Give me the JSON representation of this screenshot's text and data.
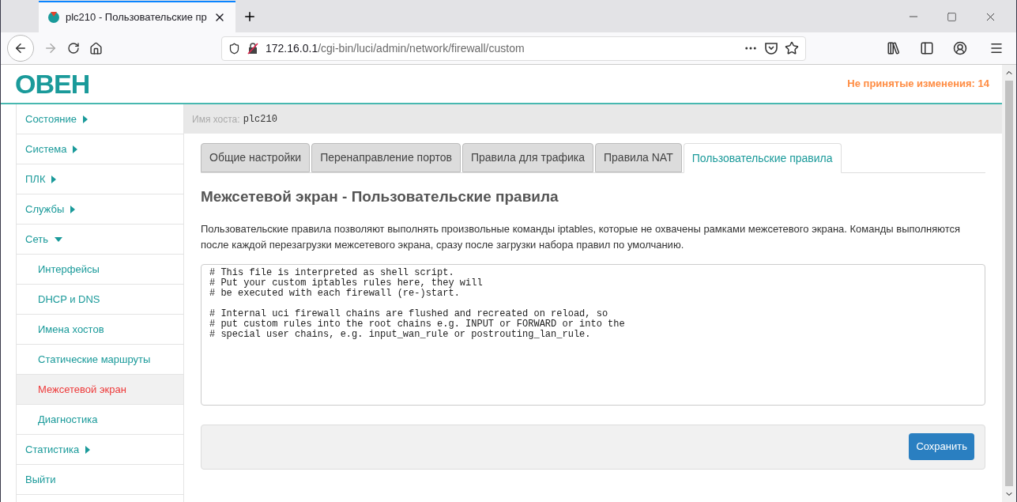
{
  "browser": {
    "tab_title": "plc210 - Пользовательские пр",
    "url_host": "172.16.0.1",
    "url_path": "/cgi-bin/luci/admin/network/firewall/custom"
  },
  "header": {
    "logo": "ОВЕН",
    "pending_changes": "Не принятые изменения: 14"
  },
  "sidebar": {
    "items": [
      {
        "label": "Состояние",
        "kind": "menu",
        "expanded": false
      },
      {
        "label": "Система",
        "kind": "menu",
        "expanded": false
      },
      {
        "label": "ПЛК",
        "kind": "menu",
        "expanded": false
      },
      {
        "label": "Службы",
        "kind": "menu",
        "expanded": false
      },
      {
        "label": "Сеть",
        "kind": "menu",
        "expanded": true,
        "children": [
          {
            "label": "Интерфейсы",
            "selected": false
          },
          {
            "label": "DHCP и DNS",
            "selected": false
          },
          {
            "label": "Имена хостов",
            "selected": false
          },
          {
            "label": "Статические маршруты",
            "selected": false
          },
          {
            "label": "Межсетевой экран",
            "selected": true
          },
          {
            "label": "Диагностика",
            "selected": false
          }
        ]
      },
      {
        "label": "Статистика",
        "kind": "menu",
        "expanded": false
      },
      {
        "label": "Выйти",
        "kind": "link"
      }
    ]
  },
  "hostname": {
    "label": "Имя хоста:",
    "value": "plc210"
  },
  "tabs": [
    {
      "label": "Общие настройки",
      "selected": false
    },
    {
      "label": "Перенаправление портов",
      "selected": false
    },
    {
      "label": "Правила для трафика",
      "selected": false
    },
    {
      "label": "Правила NAT",
      "selected": false
    },
    {
      "label": "Пользовательские правила",
      "selected": true
    }
  ],
  "title": "Межсетевой экран - Пользовательские правила",
  "description": "Пользовательские правила позволяют выполнять произвольные команды iptables, которые не охвачены рамками межсетевого экрана. Команды выполняются после каждой перезагрузки межсетевого экрана, сразу после загрузки набора правил по умолчанию.",
  "script": "# This file is interpreted as shell script.\n# Put your custom iptables rules here, they will\n# be executed with each firewall (re-)start.\n\n# Internal uci firewall chains are flushed and recreated on reload, so\n# put custom rules into the root chains e.g. INPUT or FORWARD or into the\n# special user chains, e.g. input_wan_rule or postrouting_lan_rule.",
  "save_button": "Сохранить"
}
